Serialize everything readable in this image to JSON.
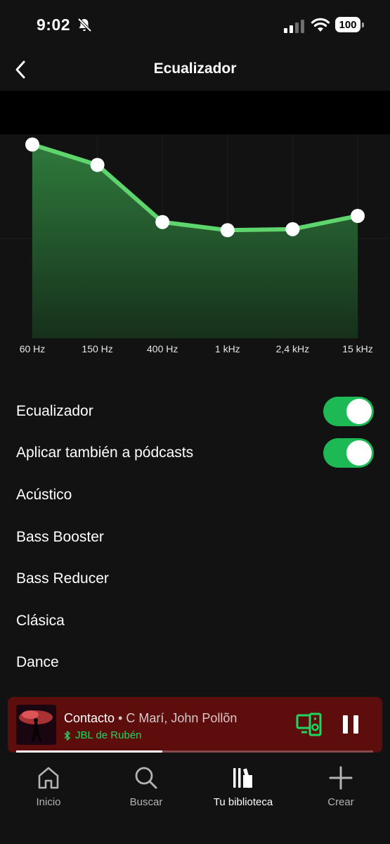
{
  "status_bar": {
    "time": "9:02",
    "battery": "100"
  },
  "header": {
    "title": "Ecualizador"
  },
  "chart_data": {
    "type": "area",
    "categories": [
      "60 Hz",
      "150 Hz",
      "400 Hz",
      "1 kHz",
      "2,4 kHz",
      "15 kHz"
    ],
    "values": [
      0.95,
      0.85,
      0.57,
      0.53,
      0.535,
      0.6
    ],
    "ylim": [
      0,
      1
    ],
    "accent": "#5fd56d"
  },
  "settings": {
    "equalizer_label": "Ecualizador",
    "equalizer_on": true,
    "podcasts_label": "Aplicar también a pódcasts",
    "podcasts_on": true,
    "presets": [
      "Acústico",
      "Bass Booster",
      "Bass Reducer",
      "Clásica",
      "Dance"
    ]
  },
  "player": {
    "title": "Contacto",
    "separator": " • ",
    "artist": "C Marí, John Pollõn",
    "device": "JBL de Rubén",
    "progress": 0.41,
    "background": "#5e0d0d"
  },
  "nav": {
    "home": "Inicio",
    "search": "Buscar",
    "library": "Tu biblioteca",
    "create": "Crear"
  }
}
